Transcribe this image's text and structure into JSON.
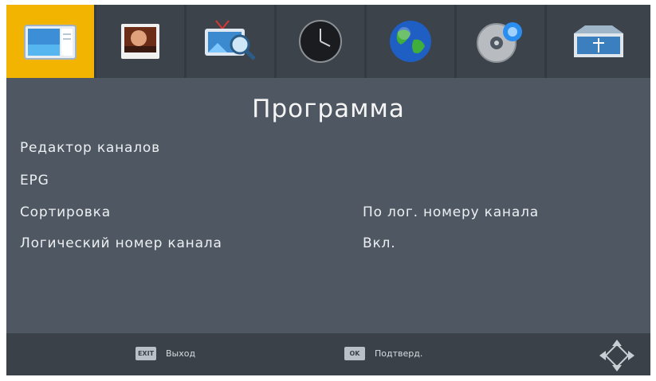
{
  "tabs": [
    {
      "icon": "picture-settings-icon",
      "active": true
    },
    {
      "icon": "image-icon",
      "active": false
    },
    {
      "icon": "channel-search-icon",
      "active": false
    },
    {
      "icon": "clock-icon",
      "active": false
    },
    {
      "icon": "globe-icon",
      "active": false
    },
    {
      "icon": "system-disc-icon",
      "active": false
    },
    {
      "icon": "usb-media-icon",
      "active": false
    }
  ],
  "title": "Программа",
  "menu": [
    {
      "label": "Редактор каналов",
      "value": ""
    },
    {
      "label": "EPG",
      "value": ""
    },
    {
      "label": "Сортировка",
      "value": "По лог. номеру канала"
    },
    {
      "label": "Логический номер канала",
      "value": "Вкл."
    }
  ],
  "footer": {
    "exit_key": "EXIT",
    "exit_label": "Выход",
    "ok_key": "OK",
    "ok_label": "Подтверд."
  },
  "colors": {
    "active_tab": "#f2b400",
    "background": "#4f5862"
  }
}
